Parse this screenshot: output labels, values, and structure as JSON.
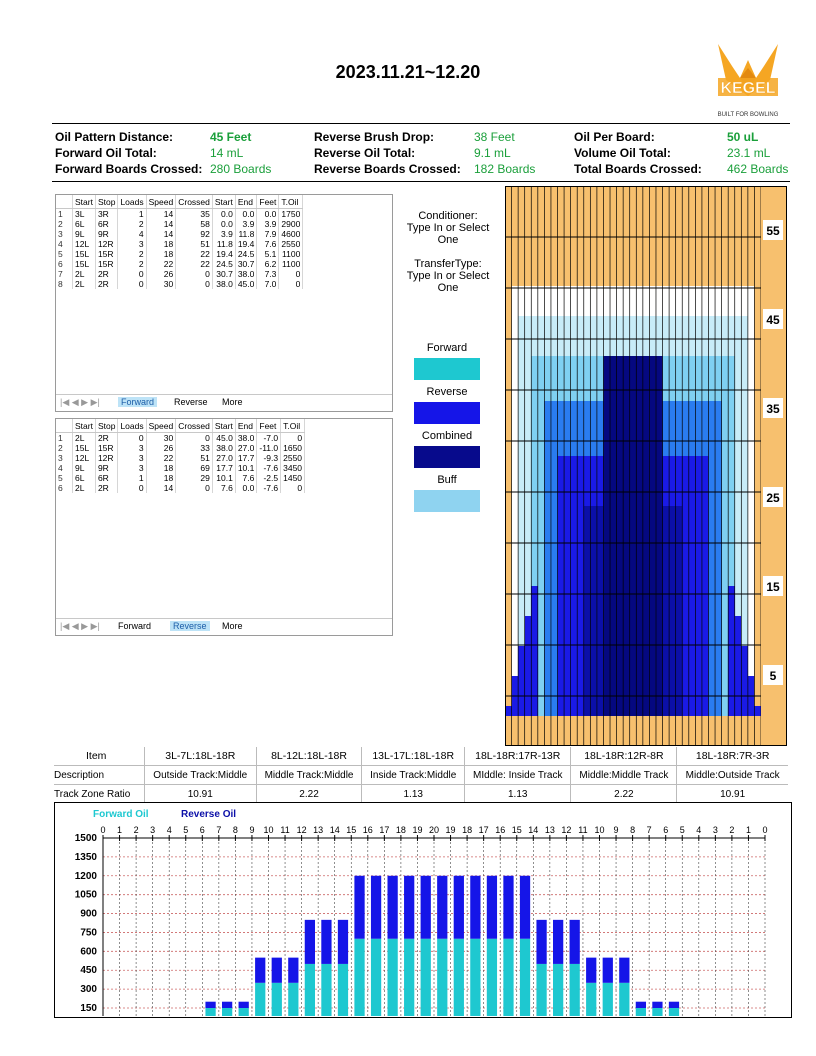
{
  "title": "2023.11.21~12.20",
  "logo": {
    "name": "KEGEL",
    "tagline": "BUILT FOR BOWLING"
  },
  "summary": {
    "oil_pattern_distance_label": "Oil Pattern Distance:",
    "oil_pattern_distance": "45 Feet",
    "forward_oil_total_label": "Forward Oil Total:",
    "forward_oil_total": "14 mL",
    "forward_boards_crossed_label": "Forward Boards Crossed:",
    "forward_boards_crossed": "280 Boards",
    "reverse_brush_drop_label": "Reverse Brush Drop:",
    "reverse_brush_drop": "38 Feet",
    "reverse_oil_total_label": "Reverse Oil Total:",
    "reverse_oil_total": "9.1 mL",
    "reverse_boards_crossed_label": "Reverse Boards Crossed:",
    "reverse_boards_crossed": "182 Boards",
    "oil_per_board_label": "Oil Per Board:",
    "oil_per_board": "50 uL",
    "volume_oil_total_label": "Volume Oil Total:",
    "volume_oil_total": "23.1 mL",
    "total_boards_crossed_label": "Total Boards Crossed:",
    "total_boards_crossed": "462 Boards",
    "value_color": "#1a9f3a"
  },
  "table_headers": [
    "",
    "Start",
    "Stop",
    "Loads",
    "Speed",
    "Crossed",
    "Start",
    "End",
    "Feet",
    "T.Oil"
  ],
  "forward_table": {
    "rows": [
      [
        "1",
        "3L",
        "3R",
        "1",
        "14",
        "35",
        "0.0",
        "0.0",
        "0.0",
        "1750"
      ],
      [
        "2",
        "6L",
        "6R",
        "2",
        "14",
        "58",
        "0.0",
        "3.9",
        "3.9",
        "2900"
      ],
      [
        "3",
        "9L",
        "9R",
        "4",
        "14",
        "92",
        "3.9",
        "11.8",
        "7.9",
        "4600"
      ],
      [
        "4",
        "12L",
        "12R",
        "3",
        "18",
        "51",
        "11.8",
        "19.4",
        "7.6",
        "2550"
      ],
      [
        "5",
        "15L",
        "15R",
        "2",
        "18",
        "22",
        "19.4",
        "24.5",
        "5.1",
        "1100"
      ],
      [
        "6",
        "15L",
        "15R",
        "2",
        "22",
        "22",
        "24.5",
        "30.7",
        "6.2",
        "1100"
      ],
      [
        "7",
        "2L",
        "2R",
        "0",
        "26",
        "0",
        "30.7",
        "38.0",
        "7.3",
        "0"
      ],
      [
        "8",
        "2L",
        "2R",
        "0",
        "30",
        "0",
        "38.0",
        "45.0",
        "7.0",
        "0"
      ]
    ],
    "tabs": [
      "Forward",
      "Reverse",
      "More"
    ],
    "active_tab": "Forward"
  },
  "reverse_table": {
    "rows": [
      [
        "1",
        "2L",
        "2R",
        "0",
        "30",
        "0",
        "45.0",
        "38.0",
        "-7.0",
        "0"
      ],
      [
        "2",
        "15L",
        "15R",
        "3",
        "26",
        "33",
        "38.0",
        "27.0",
        "-11.0",
        "1650"
      ],
      [
        "3",
        "12L",
        "12R",
        "3",
        "22",
        "51",
        "27.0",
        "17.7",
        "-9.3",
        "2550"
      ],
      [
        "4",
        "9L",
        "9R",
        "3",
        "18",
        "69",
        "17.7",
        "10.1",
        "-7.6",
        "3450"
      ],
      [
        "5",
        "6L",
        "6R",
        "1",
        "18",
        "29",
        "10.1",
        "7.6",
        "-2.5",
        "1450"
      ],
      [
        "6",
        "2L",
        "2R",
        "0",
        "14",
        "0",
        "7.6",
        "0.0",
        "-7.6",
        "0"
      ]
    ],
    "tabs": [
      "Forward",
      "Reverse",
      "More"
    ],
    "active_tab": "Reverse"
  },
  "conditioner": {
    "line1": "Conditioner:",
    "line2": "Type In or Select",
    "line3": "One"
  },
  "transfer": {
    "line1": "TransferType:",
    "line2": "Type In or Select",
    "line3": "One"
  },
  "legend": [
    {
      "label": "Forward",
      "color": "#1ec8d0"
    },
    {
      "label": "Reverse",
      "color": "#1515e8"
    },
    {
      "label": "Combined",
      "color": "#070a8c"
    },
    {
      "label": "Buff",
      "color": "#8fd3f0"
    }
  ],
  "oil_grid": {
    "distance_labels": [
      "55",
      "45",
      "35",
      "25",
      "15",
      "5"
    ],
    "colors": {
      "dry": "#f7c06e",
      "white": "#ffffff",
      "buff": "#c8ecf8",
      "light": "#7fd0f2",
      "mid": "#2a7cf0",
      "reverse": "#1a1ae6",
      "combined": "#0b0fa8",
      "deep": "#050880"
    }
  },
  "track_table": {
    "item_label": "Item",
    "description_label": "Description",
    "ratio_label": "Track Zone Ratio",
    "items": [
      "3L-7L:18L-18R",
      "8L-12L:18L-18R",
      "13L-17L:18L-18R",
      "18L-18R:17R-13R",
      "18L-18R:12R-8R",
      "18L-18R:7R-3R"
    ],
    "descriptions": [
      "Outside Track:Middle",
      "Middle Track:Middle",
      "Inside Track:Middle",
      "MIddle: Inside Track",
      "Middle:Middle Track",
      "Middle:Outside Track"
    ],
    "ratios": [
      "10.91",
      "2.22",
      "1.13",
      "1.13",
      "2.22",
      "10.91"
    ]
  },
  "chart_data": {
    "type": "bar",
    "legend": [
      "Forward Oil",
      "Reverse Oil"
    ],
    "board_labels": [
      "0",
      "1",
      "2",
      "3",
      "4",
      "5",
      "6",
      "7",
      "8",
      "9",
      "10",
      "11",
      "12",
      "13",
      "14",
      "15",
      "16",
      "17",
      "18",
      "19",
      "20",
      "19",
      "18",
      "17",
      "16",
      "15",
      "14",
      "13",
      "12",
      "11",
      "10",
      "9",
      "8",
      "7",
      "6",
      "5",
      "4",
      "3",
      "2",
      "1",
      "0"
    ],
    "y_ticks": [
      "1500",
      "1350",
      "1200",
      "1050",
      "900",
      "750",
      "600",
      "450",
      "300",
      "150"
    ],
    "ylim": [
      0,
      1500
    ],
    "series": [
      {
        "name": "Forward Oil",
        "color": "#1ec8d0",
        "values": [
          0,
          0,
          0,
          0,
          0,
          0,
          150,
          150,
          150,
          350,
          350,
          350,
          500,
          500,
          500,
          700,
          700,
          700,
          700,
          700,
          700,
          700,
          700,
          700,
          700,
          700,
          500,
          500,
          500,
          350,
          350,
          350,
          150,
          150,
          150,
          0,
          0,
          0,
          0,
          0,
          0
        ]
      },
      {
        "name": "Reverse Oil",
        "color": "#1515e8",
        "values": [
          0,
          0,
          0,
          0,
          0,
          0,
          50,
          50,
          50,
          200,
          200,
          200,
          350,
          350,
          350,
          500,
          500,
          500,
          500,
          500,
          500,
          500,
          500,
          500,
          500,
          500,
          350,
          350,
          350,
          200,
          200,
          200,
          50,
          50,
          50,
          0,
          0,
          0,
          0,
          0,
          0
        ]
      }
    ]
  }
}
